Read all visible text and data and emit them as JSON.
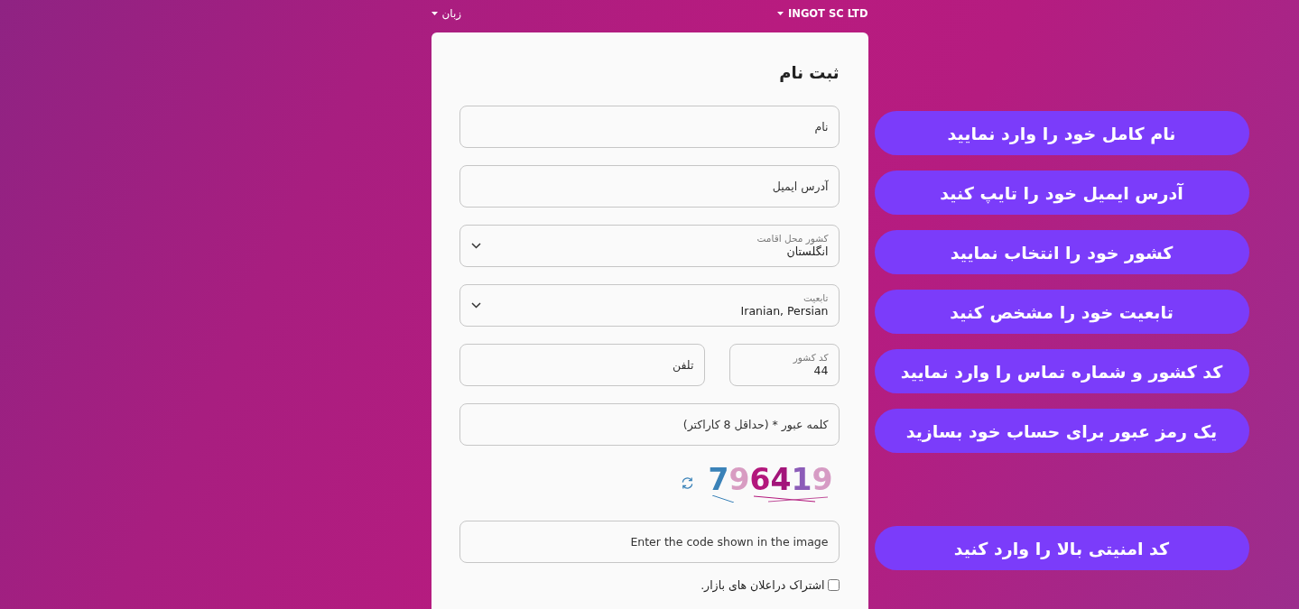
{
  "top_bar": {
    "company": {
      "label": "INGOT SC LTD"
    },
    "language": {
      "label": "زبان"
    }
  },
  "form": {
    "title": "ثبت نام",
    "fields": [
      {
        "kind": "text",
        "placeholder": "نام"
      },
      {
        "kind": "text",
        "placeholder": "آدرس ایمیل"
      },
      {
        "kind": "select",
        "label": "کشور محل اقامت",
        "value": "انگلستان"
      },
      {
        "kind": "select",
        "label": "تابعیت",
        "value": "Iranian, Persian"
      },
      {
        "kind": "phone",
        "country_code": {
          "label": "کد کشور",
          "value": "44"
        },
        "phone": {
          "placeholder": "تلفن"
        }
      },
      {
        "kind": "password",
        "placeholder": "کلمه عبور * (حداقل 8 کاراکتر)"
      },
      {
        "kind": "captcha",
        "code": "796419"
      },
      {
        "kind": "text",
        "placeholder": "Enter the code shown in the image"
      },
      {
        "kind": "checkbox",
        "label": "اشتراک دراعلان های بازار.",
        "checked": false
      }
    ]
  },
  "callouts": [
    "نام کامل خود را وارد نمایید",
    "آدرس ایمیل خود را تایپ کنید",
    "کشور خود را انتخاب نمایید",
    "تابعیت خود را مشخص کنید",
    "کد کشور و شماره تماس را وارد نمایید",
    "یک رمز عبور برای حساب خود بسازید",
    "کد امنیتی بالا را وارد کنید"
  ]
}
